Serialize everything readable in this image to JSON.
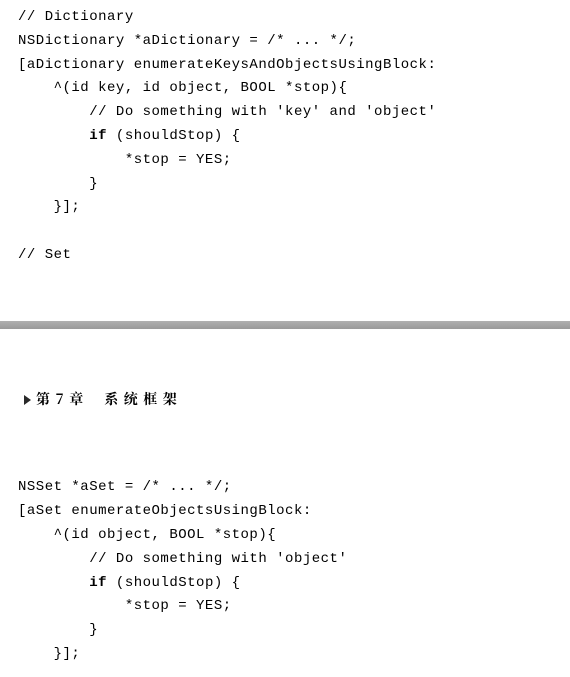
{
  "top": {
    "comment_dictionary": "// Dictionary",
    "line_decl": "NSDictionary *aDictionary = /* ... */;",
    "line_msg": "[aDictionary enumerateKeysAndObjectsUsingBlock:",
    "line_block": "    ^(id key, id object, BOOL *stop){",
    "line_comment2": "        // Do something with 'key' and 'object'",
    "line_if_pre": "        ",
    "kw_if": "if",
    "line_if_post": " (shouldStop) {",
    "line_stop": "            *stop = YES;",
    "line_close1": "        }",
    "line_close2": "    }];",
    "comment_set": "// Set"
  },
  "chapter": {
    "number": "第 7 章",
    "title": "系 统 框 架"
  },
  "bottom": {
    "line_decl": "NSSet *aSet = /* ... */;",
    "line_msg": "[aSet enumerateObjectsUsingBlock:",
    "line_block": "    ^(id object, BOOL *stop){",
    "line_comment2": "        // Do something with 'object'",
    "line_if_pre": "        ",
    "kw_if": "if",
    "line_if_post": " (shouldStop) {",
    "line_stop": "            *stop = YES;",
    "line_close1": "        }",
    "line_close2": "    }];"
  }
}
